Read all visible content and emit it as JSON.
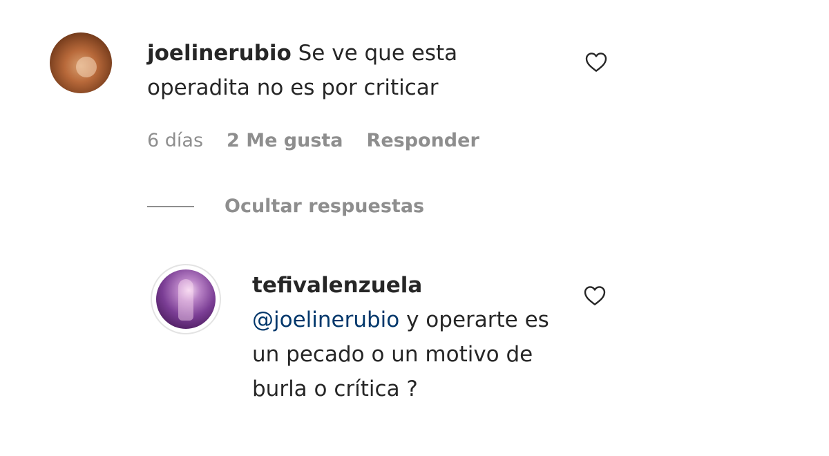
{
  "comment": {
    "username": "joelinerubio",
    "text": "Se ve que esta operadita no es por criticar",
    "age": "6 días",
    "likes": "2 Me gusta",
    "reply_label": "Responder",
    "avatar_icon": "profile-photo-avatar",
    "like_icon": "heart-outline-icon"
  },
  "replies_toggle": {
    "label": "Ocultar respuestas"
  },
  "reply": {
    "username": "tefivalenzuela",
    "mention": "@joelinerubio",
    "text": "y operarte es un pecado o un motivo de burla o crítica ?",
    "avatar_icon": "profile-photo-avatar",
    "like_icon": "heart-outline-icon"
  },
  "colors": {
    "text": "#262626",
    "secondary": "#8e8e8e",
    "mention": "#00376b"
  }
}
